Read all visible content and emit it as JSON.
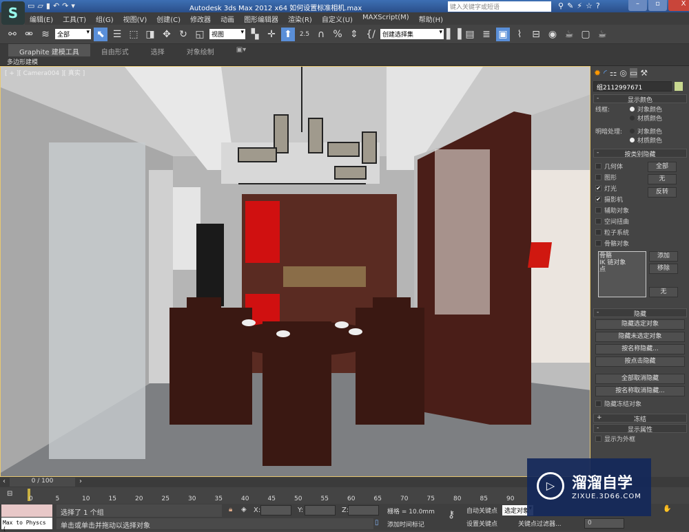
{
  "titlebar": {
    "title": "Autodesk 3ds Max  2012 x64     如何设置标准相机.max",
    "search_placeholder": "键入关键字或短语",
    "logo": "S"
  },
  "menu": [
    "编辑(E)",
    "工具(T)",
    "组(G)",
    "视图(V)",
    "创建(C)",
    "修改器",
    "动画",
    "图形编辑器",
    "渲染(R)",
    "自定义(U)",
    "MAXScript(M)",
    "帮助(H)"
  ],
  "toolbar": {
    "filter": "全部",
    "ref_coord": "视图",
    "snap_angle": "2.5",
    "named_selection": "创建选择集"
  },
  "ribbon": {
    "tabs": [
      "Graphite 建模工具",
      "自由形式",
      "选择",
      "对象绘制"
    ],
    "sub": "多边形建模"
  },
  "viewport": {
    "label": "[ + ][ Camera004 ][ 真实 ]"
  },
  "command_panel": {
    "object_name": "组2112997671",
    "object_color": "#c8d890",
    "display_color": {
      "title": "显示颜色",
      "wireframe_label": "线框:",
      "shaded_label": "明暗处理:",
      "opt_object": "对象颜色",
      "opt_material": "材质颜色",
      "wireframe_selected": "对象颜色",
      "shaded_selected": "材质颜色"
    },
    "hide_by_category": {
      "title": "按类别隐藏",
      "items": [
        {
          "label": "几何体",
          "checked": false
        },
        {
          "label": "图形",
          "checked": false
        },
        {
          "label": "灯光",
          "checked": true
        },
        {
          "label": "摄影机",
          "checked": true
        },
        {
          "label": "辅助对象",
          "checked": false
        },
        {
          "label": "空间扭曲",
          "checked": false
        },
        {
          "label": "粒子系统",
          "checked": false
        },
        {
          "label": "骨骼对象",
          "checked": false
        }
      ],
      "btn_all": "全部",
      "btn_none": "无",
      "btn_invert": "反转",
      "list": [
        "骨骼",
        "IK 链对象",
        "点"
      ],
      "btn_add": "添加",
      "btn_remove": "移除",
      "btn_none2": "无"
    },
    "hide": {
      "title": "隐藏",
      "buttons": [
        "隐藏选定对象",
        "隐藏未选定对象",
        "按名称隐藏...",
        "按点击隐藏"
      ],
      "buttons2": [
        "全部取消隐藏",
        "按名称取消隐藏..."
      ],
      "frozen_label": "隐藏冻结对象"
    },
    "freeze": {
      "title": "冻结"
    },
    "display_props": {
      "title": "显示属性",
      "first_item": "显示为外框"
    }
  },
  "timeline": {
    "position": "0 / 100",
    "ticks": [
      "0",
      "5",
      "10",
      "15",
      "20",
      "25",
      "30",
      "35",
      "40",
      "45",
      "50",
      "55",
      "60",
      "65",
      "70",
      "75",
      "80",
      "85",
      "90"
    ]
  },
  "status": {
    "script_listener": "Max to Physcs (",
    "selection": "选择了 1 个组",
    "prompt": "单击或单击并拖动以选择对象",
    "x_label": "X:",
    "y_label": "Y:",
    "z_label": "Z:",
    "grid": "栅格 = 10.0mm",
    "add_time_tag": "添加时间标记",
    "auto_key": "自动关键点",
    "set_key": "设置关键点",
    "selected_dropdown": "选定对象",
    "key_filters": "关键点过滤器...",
    "frame": "0"
  },
  "watermark": {
    "brand": "溜溜自学",
    "url": "ZIXUE.3D66.COM"
  }
}
